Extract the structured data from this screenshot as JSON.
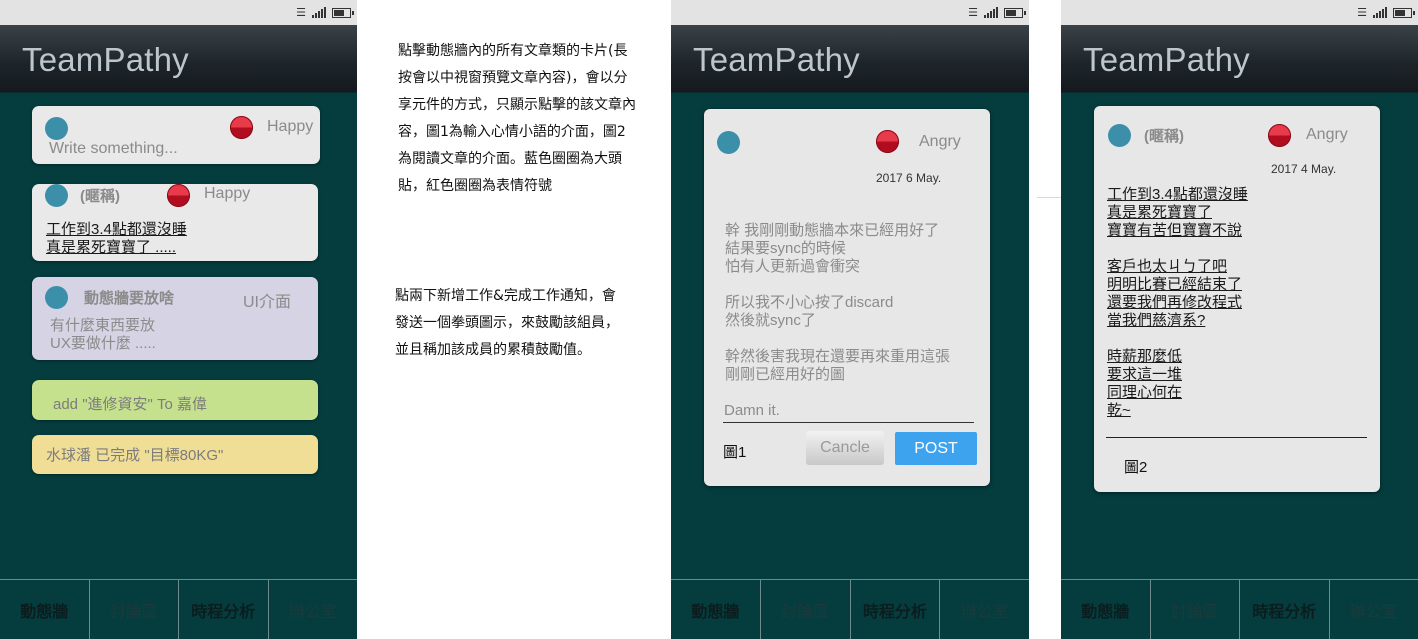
{
  "app": {
    "title": "TeamPathy"
  },
  "nav": {
    "tabs": [
      "動態牆",
      "討論區",
      "時程分析",
      "辦公室"
    ]
  },
  "screen1": {
    "compose": {
      "placeholder": "Write something...",
      "mood": "Happy"
    },
    "posts": [
      {
        "author": "(暱稱)",
        "mood": "Happy",
        "lines": [
          "工作到3.4點都還沒睡",
          "真是累死寶寶了 ....."
        ]
      },
      {
        "author": "動態牆要放啥",
        "tag": "UI介面",
        "lines": [
          "有什麼東西要放",
          "UX要做什麼 ....."
        ]
      }
    ],
    "notifications": [
      {
        "text": "add \"進修資安\" To 嘉偉",
        "color": "#c6e18d"
      },
      {
        "text": "水球潘 已完成 \"目標80KG\"",
        "color": "#f0de97"
      }
    ]
  },
  "description": {
    "para1": "點擊動態牆內的所有文章類的卡片(長按會以中視窗預覽文章內容)，會以分享元件的方式，只顯示點擊的該文章內容，圖1為輸入心情小語的介面，圖2為閱讀文章的介面。藍色圈圈為大頭貼，紅色圈圈為表情符號",
    "para2": "點兩下新增工作&完成工作通知，會發送一個拳頭圖示，來鼓勵該組員，並且稱加該成員的累積鼓勵值。"
  },
  "screen2": {
    "mood": "Angry",
    "date": "2017  6 May.",
    "body": [
      "幹 我剛剛動態牆本來已經用好了",
      "結果要sync的時候",
      "怕有人更新過會衝突",
      "",
      "所以我不小心按了discard",
      "然後就sync了",
      "",
      "幹然後害我現在還要再來重用這張",
      "剛剛已經用好的圖"
    ],
    "input_value": "Damn it.",
    "figure_label": "圖1",
    "cancel_label": "Cancle",
    "post_label": "POST"
  },
  "screen3": {
    "author": "(暱稱)",
    "mood": "Angry",
    "date": "2017  4  May.",
    "body": [
      "工作到3.4點都還沒睡",
      "真是累死寶寶了 ",
      "寶寶有苦但寶寶不說",
      "",
      "客戶也太ㄐㄅ了吧",
      "明明比賽已經結束了",
      "還要我們再修改程式",
      "當我們慈濟系?",
      "",
      "時薪那麼低",
      "要求這一堆",
      "同理心何在",
      "乾~"
    ],
    "figure_label": "圖2"
  },
  "colors": {
    "background": "#053d3f",
    "post_button": "#3ea3ee",
    "avatar": "#3b8fa8",
    "mood": "#c8142a"
  }
}
